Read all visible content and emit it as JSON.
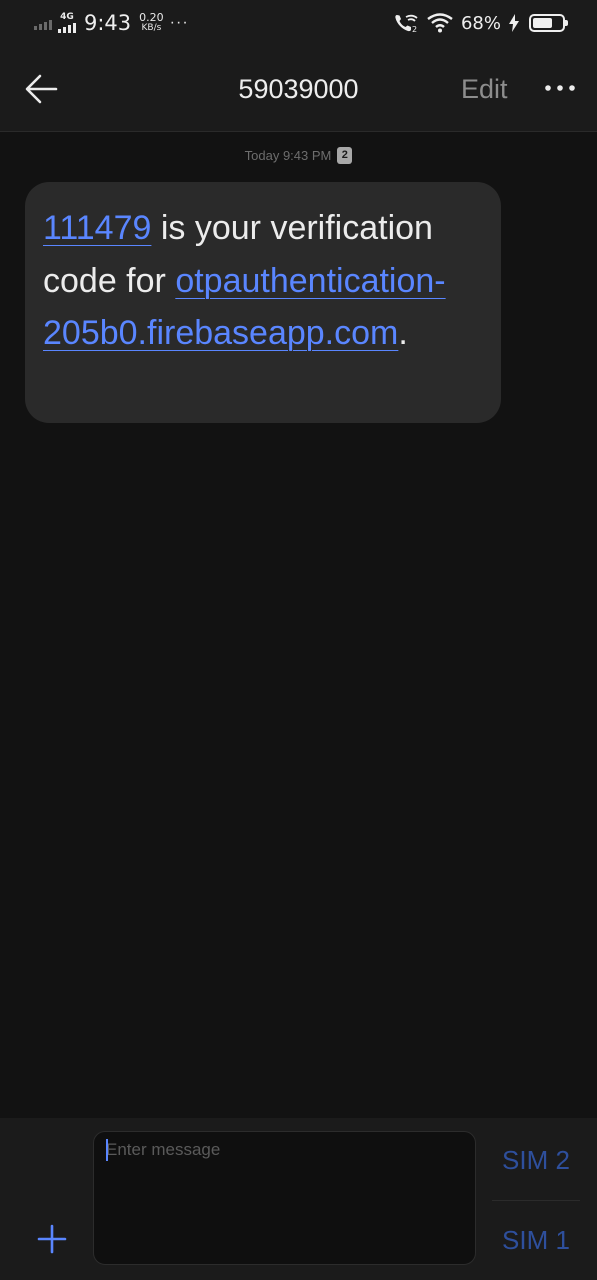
{
  "status_bar": {
    "network_type": "4G",
    "time": "9:43",
    "speed_value": "0.20",
    "speed_unit": "KB/s",
    "more_dots": "···",
    "battery_percent": "68%",
    "battery_level": 0.68,
    "icons": [
      "signal-icon",
      "wifi-calling-icon",
      "wifi-icon",
      "charging-icon",
      "battery-icon"
    ]
  },
  "header": {
    "title": "59039000",
    "edit_label": "Edit",
    "icons": [
      "back-arrow-icon",
      "more-icon"
    ]
  },
  "conversation": {
    "timestamp": "Today 9:43 PM",
    "sim_badge": "2",
    "message": {
      "code": "111479",
      "text_middle": " is your verification code for ",
      "link": "otpauthentication-205b0.firebaseapp.com",
      "text_end": "."
    }
  },
  "composer": {
    "placeholder": "Enter message",
    "sim2_label": "SIM 2",
    "sim1_label": "SIM 1",
    "icons": [
      "plus-icon"
    ]
  },
  "colors": {
    "background": "#121212",
    "bar": "#1b1b1b",
    "bubble": "#2a2a2a",
    "link": "#5a86ff",
    "sim_button": "#2e4f9c"
  }
}
